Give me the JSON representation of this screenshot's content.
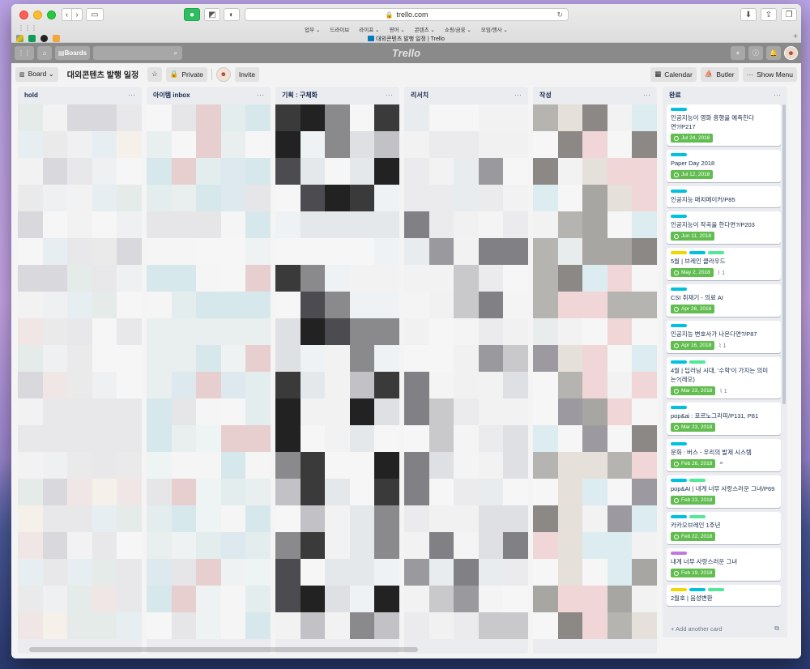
{
  "browser": {
    "url": "trello.com",
    "favorites": [
      "업무 ⌄",
      "드라이브",
      "라이프 ⌄",
      "영어 ⌄",
      "콘텐츠 ⌄",
      "쇼핑/금융 ⌄",
      "모임/행사 ⌄"
    ],
    "tab_title": "대외콘텐츠 발행 일정 | Trello"
  },
  "header": {
    "boards_label": "Boards",
    "logo": "Trello"
  },
  "boardbar": {
    "board_menu": "Board ⌄",
    "title": "대외콘텐츠 발행 일정",
    "private_label": "Private",
    "invite_label": "Invite",
    "calendar_label": "Calendar",
    "butler_label": "Butler",
    "menu_label": "Show Menu"
  },
  "lists": [
    {
      "title": "hold"
    },
    {
      "title": "아이템 inbox"
    },
    {
      "title": "기획 : 구체화"
    },
    {
      "title": "리서치"
    },
    {
      "title": "작성"
    },
    {
      "title": "완료"
    }
  ],
  "done_cards": [
    {
      "labels": [
        "#00c2e0"
      ],
      "title": "인공지능이 영화 흥행을 예측한다면?/P217",
      "due": "Jul 24, 2018",
      "badge": ""
    },
    {
      "labels": [
        "#00c2e0"
      ],
      "title": "Paper Day 2018",
      "due": "Jul 12, 2018",
      "badge": ""
    },
    {
      "labels": [
        "#00c2e0"
      ],
      "title": "인공지능 매치메이커/P85",
      "due": "",
      "badge": ""
    },
    {
      "labels": [
        "#00c2e0"
      ],
      "title": "인공지능이 작곡을 한다면?/P203",
      "due": "Jun 11, 2018",
      "badge": ""
    },
    {
      "labels": [
        "#f2d600",
        "#00c2e0",
        "#51e898"
      ],
      "title": "5월 | 브레인 클라우드",
      "due": "May 2, 2018",
      "badge": "1"
    },
    {
      "labels": [
        "#00c2e0"
      ],
      "title": "CSI 취재기 - 의료 AI",
      "due": "Apr 26, 2018",
      "badge": ""
    },
    {
      "labels": [
        "#00c2e0"
      ],
      "title": "인공지능 변호사가 나온다면?/P87",
      "due": "Apr 16, 2018",
      "badge": "1"
    },
    {
      "labels": [
        "#00c2e0",
        "#51e898"
      ],
      "title": "4월 | 딥러닝 시대, '수학'이 가지는 의미는?(레오)",
      "due": "Mar 23, 2018",
      "badge": "1"
    },
    {
      "labels": [
        "#00c2e0"
      ],
      "title": "pop&ai : 포르노그라피/P131, P81",
      "due": "Mar 23, 2018",
      "badge": ""
    },
    {
      "labels": [
        "#00c2e0"
      ],
      "title": "문화 : 버스 - 우리의 발제 시스템",
      "due": "Feb 26, 2018",
      "badge": "desc"
    },
    {
      "labels": [
        "#00c2e0",
        "#51e898"
      ],
      "title": "pop&AI | 내게 너무 사랑스러운 그녀/P69",
      "due": "Feb 23, 2018",
      "badge": ""
    },
    {
      "labels": [
        "#00c2e0",
        "#51e898"
      ],
      "title": "카카오브레인 1주년",
      "due": "Feb 22, 2018",
      "badge": ""
    },
    {
      "labels": [
        "#c377e0"
      ],
      "title": "내게 너무 사랑스러운 그녀",
      "due": "Feb 19, 2018",
      "badge": ""
    },
    {
      "labels": [
        "#f2d600",
        "#00c2e0",
        "#51e898"
      ],
      "title": "2월호 | 음성변환",
      "due": "",
      "badge": ""
    }
  ],
  "add_card_label": "+ Add another card"
}
